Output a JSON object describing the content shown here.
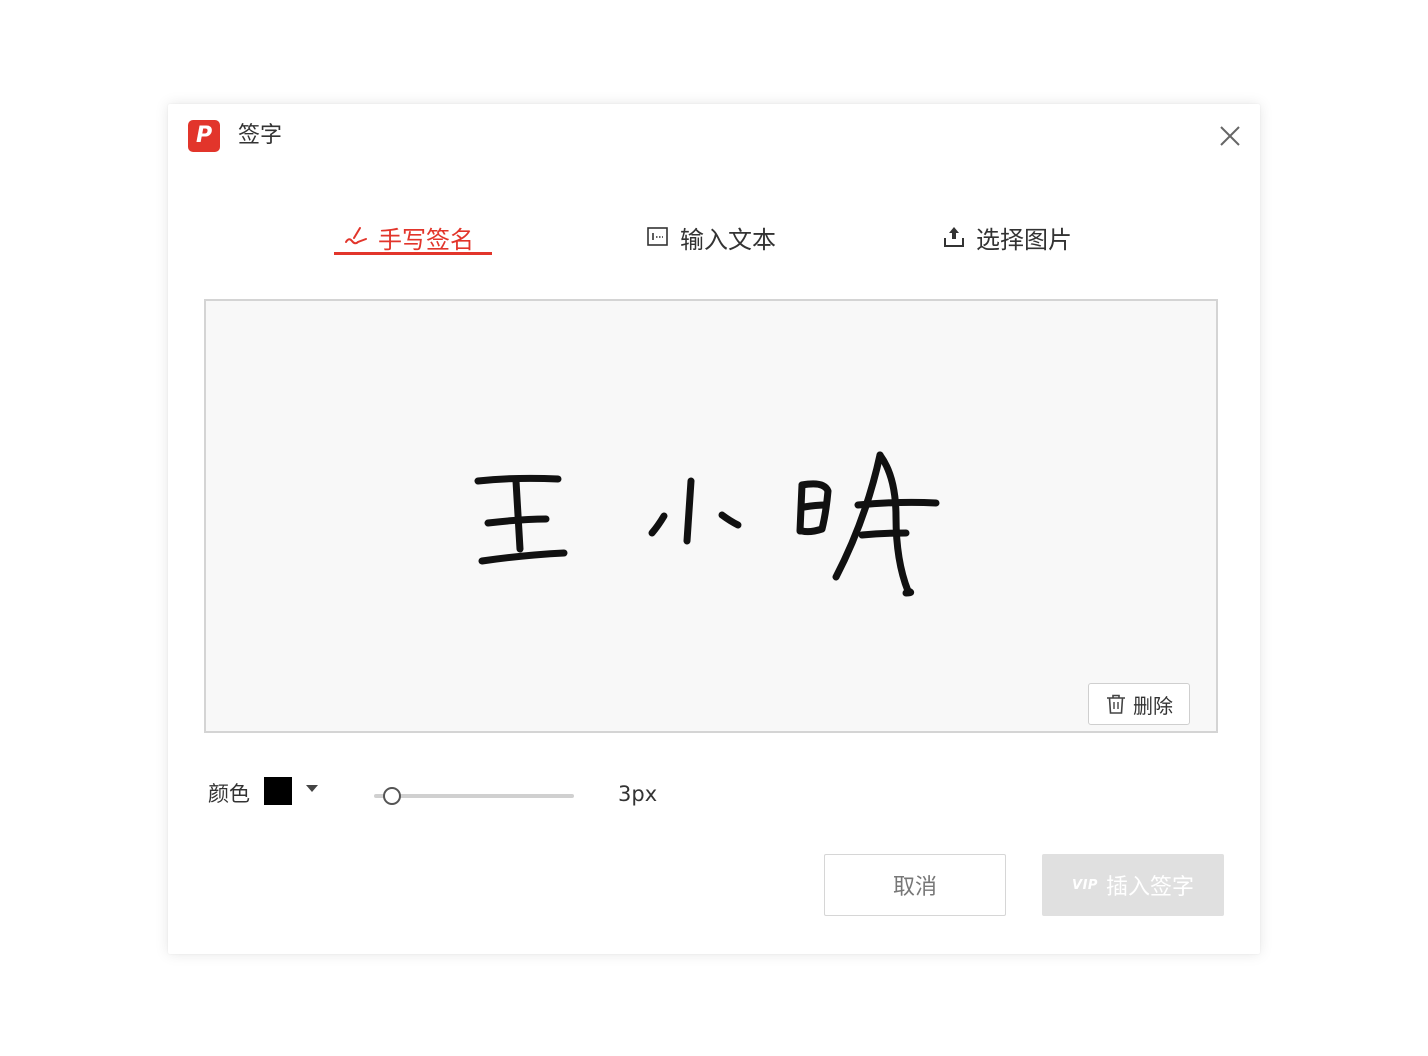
{
  "window": {
    "title": "签字",
    "logo_letter": "P",
    "close_icon": "close-icon"
  },
  "tabs": [
    {
      "label": "手写签名",
      "icon": "pen-icon",
      "active": true
    },
    {
      "label": "输入文本",
      "icon": "text-box-icon",
      "active": false
    },
    {
      "label": "选择图片",
      "icon": "upload-icon",
      "active": false
    }
  ],
  "canvas": {
    "delete_label": "删除",
    "signature_text": "王小明"
  },
  "controls": {
    "color_label": "颜色",
    "color_value": "#000000",
    "size_value": "3px",
    "size_fraction": 0.05
  },
  "footer": {
    "cancel_label": "取消",
    "vip_badge": "VIP",
    "insert_label": "插入签字"
  },
  "colors": {
    "accent": "#e2352b",
    "disabled_button": "#e0e0e0"
  }
}
